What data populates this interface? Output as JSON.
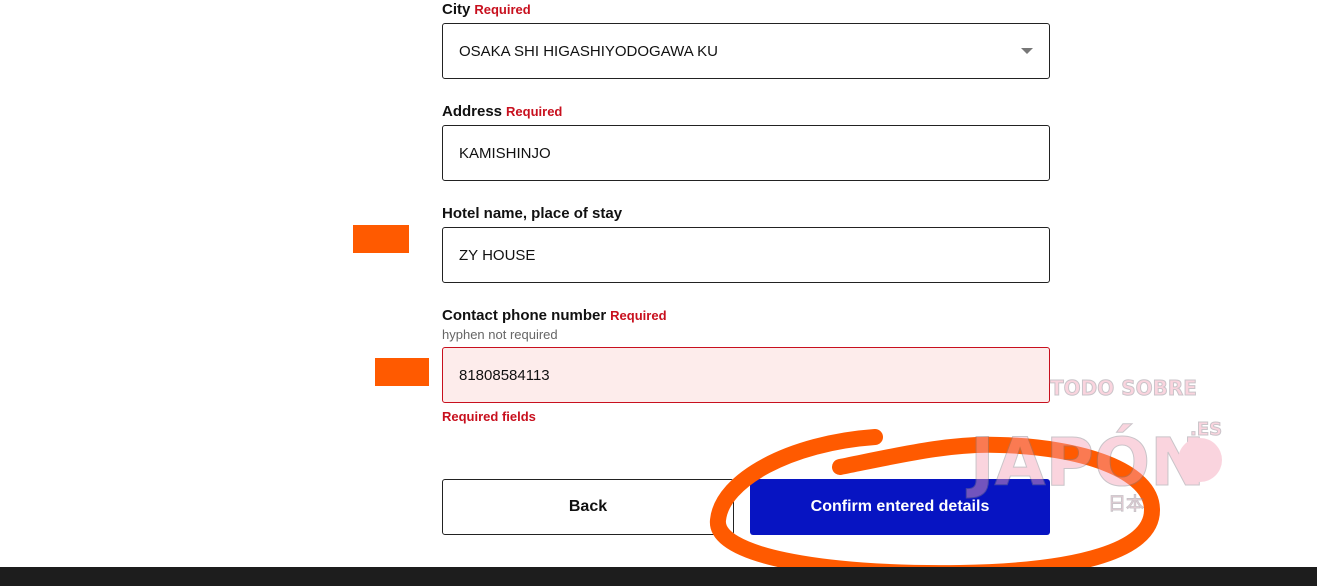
{
  "form": {
    "city": {
      "label": "City",
      "required": "Required",
      "value": "OSAKA SHI HIGASHIYODOGAWA KU"
    },
    "address": {
      "label": "Address",
      "required": "Required",
      "value": "KAMISHINJO"
    },
    "hotel": {
      "label": "Hotel name, place of stay",
      "value": "ZY HOUSE"
    },
    "phone": {
      "label": "Contact phone number",
      "required": "Required",
      "hint": "hyphen not required",
      "value": "81808584113",
      "error": "Required fields"
    }
  },
  "buttons": {
    "back": "Back",
    "confirm": "Confirm entered details"
  },
  "watermark": {
    "top": "TODO SOBRE",
    "main": "JAPÓN",
    "suffix": ".ES",
    "kanji": "日本"
  },
  "colors": {
    "accent": "#0714c2",
    "error": "#c8101e",
    "annotation": "#ff5a00"
  }
}
